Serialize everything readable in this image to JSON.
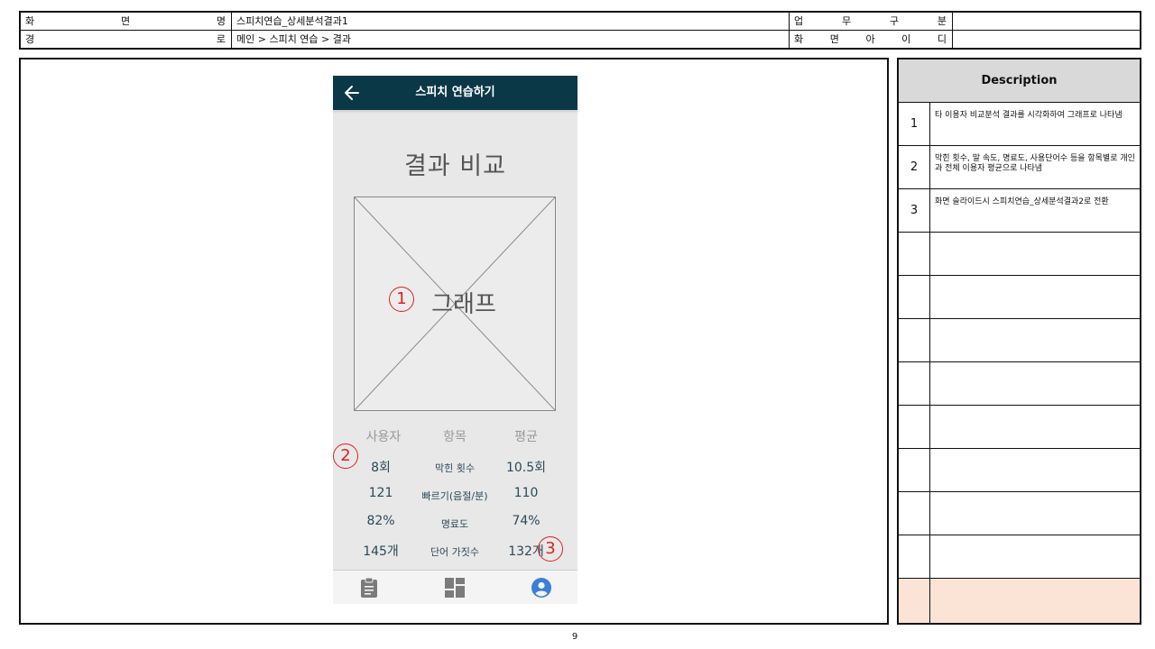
{
  "header": {
    "screen_name_label": "화면명",
    "screen_name_value": "스피치연습_상세분석결과1",
    "business_label": "업무구분",
    "business_value": "",
    "path_label": "경로",
    "path_value": "메인 > 스피치 연습 > 결과",
    "screen_id_label": "화면아이디",
    "screen_id_value": ""
  },
  "phone": {
    "appbar_title": "스피치 연습하기",
    "back_icon": "arrow-left-icon",
    "appbar_color": "#0a3847",
    "result_title": "결과 비교",
    "graph_label": "그래프",
    "stats": {
      "headers": [
        "사용자",
        "항목",
        "평균"
      ],
      "rows": [
        {
          "user": "8회",
          "item": "막힌 횟수",
          "avg": "10.5회"
        },
        {
          "user": "121",
          "item": "빠르기(음절/분)",
          "avg": "110"
        },
        {
          "user": "82%",
          "item": "명료도",
          "avg": "74%"
        },
        {
          "user": "145개",
          "item": "단어 가짓수",
          "avg": "132개"
        }
      ]
    },
    "tabs": [
      {
        "icon": "clipboard-icon"
      },
      {
        "icon": "dashboard-icon"
      },
      {
        "icon": "user-circle-icon",
        "active_color": "#3a7fd8"
      }
    ]
  },
  "markers": [
    "1",
    "2",
    "3"
  ],
  "marker_color": "#e02020",
  "description": {
    "title": "Description",
    "rows": [
      {
        "num": "1",
        "text": "타 이용자 비교분석 결과를 시각화하여 그래프로 나타냄"
      },
      {
        "num": "2",
        "text": "막힌 횟수, 말 속도, 명료도, 사용단어수 등을 항목별로 개인과 전체 이용자 평균으로 나타냄"
      },
      {
        "num": "3",
        "text": "화면 슬라이드시 스피치연습_상세분석결과2로 전환"
      },
      {
        "num": "",
        "text": ""
      },
      {
        "num": "",
        "text": ""
      },
      {
        "num": "",
        "text": ""
      },
      {
        "num": "",
        "text": ""
      },
      {
        "num": "",
        "text": ""
      },
      {
        "num": "",
        "text": ""
      },
      {
        "num": "",
        "text": ""
      },
      {
        "num": "",
        "text": ""
      },
      {
        "num": "",
        "text": ""
      }
    ],
    "last_row_color": "#fbe4d5"
  },
  "page_number": "9"
}
